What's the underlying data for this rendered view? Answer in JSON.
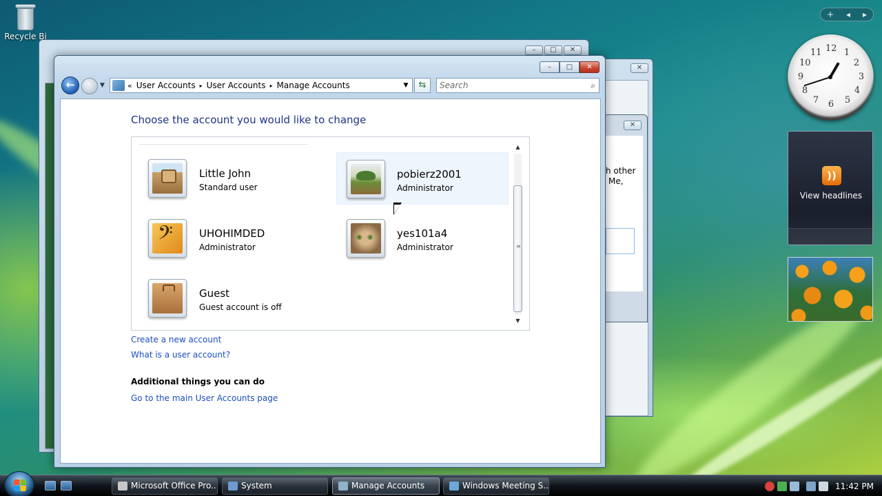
{
  "desktop": {
    "recycle_bin_label": "Recycle Bi",
    "sidebar_controls": [
      "+",
      "◂",
      "▸"
    ]
  },
  "background_window": {
    "partial_text_line1": "h other",
    "partial_text_line2": "Me,"
  },
  "window": {
    "controls": {
      "minimize": "–",
      "maximize": "□",
      "close": "✕"
    },
    "address": {
      "chevron": "«",
      "breadcrumbs": [
        "User Accounts",
        "User Accounts",
        "Manage Accounts"
      ],
      "separator": "▸"
    },
    "search_placeholder": "Search",
    "heading": "Choose the account you would like to change",
    "accounts": [
      {
        "name": "Little John",
        "role": "Standard user",
        "picture": "robot-picture"
      },
      {
        "name": "pobierz2001",
        "role": "Administrator",
        "picture": "bonsai-picture"
      },
      {
        "name": "UHOHIMDED",
        "role": "Administrator",
        "picture": "bass-clef-picture"
      },
      {
        "name": "yes101a4",
        "role": "Administrator",
        "picture": "kitten-picture"
      },
      {
        "name": "Guest",
        "role": "Guest account is off",
        "picture": "suitcase-picture"
      }
    ],
    "links": {
      "create": "Create a new account",
      "what_is": "What is a user account?"
    },
    "additional_heading": "Additional things you can do",
    "main_page_link": "Go to the main User Accounts page"
  },
  "gadgets": {
    "clock_numbers": [
      "12",
      "1",
      "2",
      "3",
      "4",
      "5",
      "6",
      "7",
      "8",
      "9",
      "10",
      "11"
    ],
    "feed_label": "View headlines"
  },
  "taskbar": {
    "tasks": [
      "Microsoft Office Pro...",
      "System",
      "Manage Accounts",
      "Windows Meeting S..."
    ],
    "active_task": "Manage Accounts",
    "time": "11:42 PM"
  }
}
